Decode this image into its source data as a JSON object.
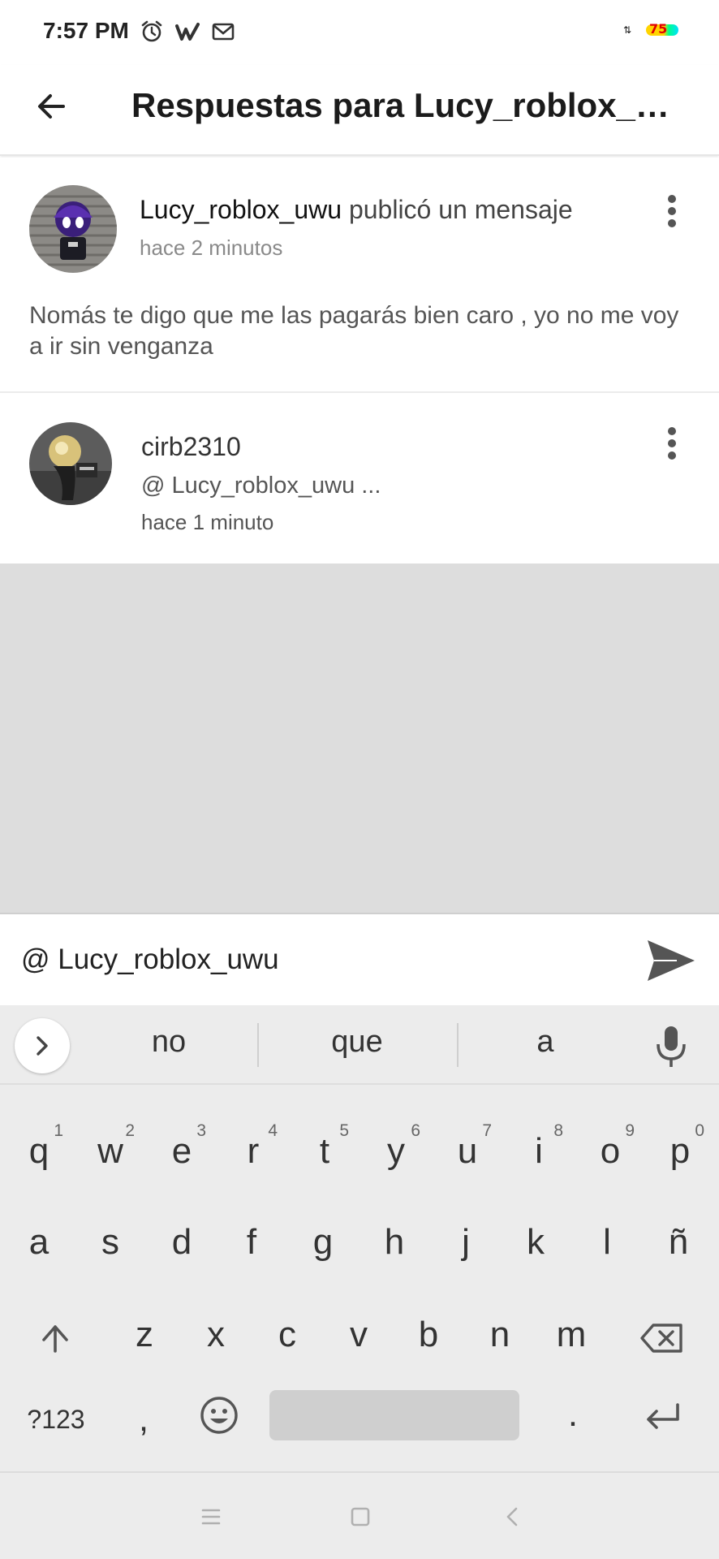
{
  "status_bar": {
    "time": "7:57 PM",
    "battery_level": "75",
    "icons": [
      "alarm-icon",
      "wattpad-icon",
      "gmail-icon"
    ]
  },
  "app_bar": {
    "title": "Respuestas para Lucy_roblox_u..."
  },
  "post": {
    "author": "Lucy_roblox_uwu",
    "action": " publicó un mensaje",
    "time": "hace 2 minutos",
    "body": "Nomás te digo que me las pagarás bien caro , yo no me voy a ir sin venganza"
  },
  "reply": {
    "author": "cirb2310",
    "mention": "@ Lucy_roblox_uwu  ...",
    "time": "hace 1 minuto"
  },
  "composer": {
    "value": "@ Lucy_roblox_uwu"
  },
  "keyboard": {
    "suggestions": [
      "no",
      "que",
      "a"
    ],
    "row1": [
      {
        "k": "q",
        "h": "1"
      },
      {
        "k": "w",
        "h": "2"
      },
      {
        "k": "e",
        "h": "3"
      },
      {
        "k": "r",
        "h": "4"
      },
      {
        "k": "t",
        "h": "5"
      },
      {
        "k": "y",
        "h": "6"
      },
      {
        "k": "u",
        "h": "7"
      },
      {
        "k": "i",
        "h": "8"
      },
      {
        "k": "o",
        "h": "9"
      },
      {
        "k": "p",
        "h": "0"
      }
    ],
    "row2": [
      "a",
      "s",
      "d",
      "f",
      "g",
      "h",
      "j",
      "k",
      "l",
      "ñ"
    ],
    "row3": [
      "z",
      "x",
      "c",
      "v",
      "b",
      "n",
      "m"
    ],
    "symbols_label": "?123",
    "comma": ",",
    "period": "."
  },
  "colors": {
    "accent": "#555555",
    "empty_area": "#dddddd",
    "keyboard_bg": "#ececec"
  }
}
